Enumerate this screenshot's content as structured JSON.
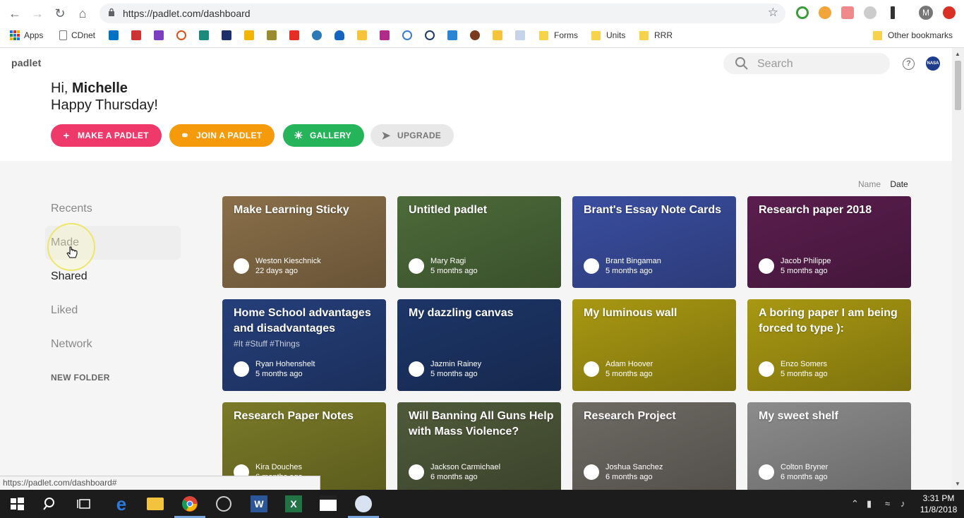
{
  "browser": {
    "url": "https://padlet.com/dashboard",
    "profile_initial": "M",
    "bookmarks": [
      {
        "label": "Apps",
        "type": "apps"
      },
      {
        "label": "CDnet",
        "type": "page"
      },
      {
        "label": "Forms",
        "type": "folder"
      },
      {
        "label": "Units",
        "type": "folder"
      },
      {
        "label": "RRR",
        "type": "folder"
      },
      {
        "label": "Other bookmarks",
        "type": "folder"
      }
    ],
    "status_url": "https://padlet.com/dashboard#"
  },
  "app": {
    "logo": "padlet",
    "search_placeholder": "Search",
    "help_label": "?",
    "avatar_text": "NASA"
  },
  "greeting": {
    "prefix": "Hi, ",
    "name": "Michelle",
    "line2": "Happy Thursday!"
  },
  "actions": {
    "make": "MAKE A PADLET",
    "join": "JOIN A PADLET",
    "gallery": "GALLERY",
    "upgrade": "UPGRADE"
  },
  "colors": {
    "make": "#f0396b",
    "join": "#f59b0b",
    "gallery": "#26b45a",
    "upgrade": "#e8e8e8"
  },
  "sort": {
    "name": "Name",
    "date": "Date",
    "active": "Date"
  },
  "sidebar": {
    "items": [
      "Recents",
      "Made",
      "Shared",
      "Liked",
      "Network"
    ],
    "active": "Shared",
    "new_folder": "NEW FOLDER"
  },
  "padlets": [
    {
      "title": "Make Learning Sticky",
      "tags": "",
      "owner": "Weston Kieschnick",
      "when": "22 days ago",
      "bg": "#8a6f49"
    },
    {
      "title": "Untitled padlet",
      "tags": "",
      "owner": "Mary Ragi",
      "when": "5 months ago",
      "bg": "#4d6b3a"
    },
    {
      "title": "Brant's Essay Note Cards",
      "tags": "",
      "owner": "Brant Bingaman",
      "when": "5 months ago",
      "bg": "#3a4ea0"
    },
    {
      "title": "Research paper 2018",
      "tags": "",
      "owner": "Jacob Philippe",
      "when": "5 months ago",
      "bg": "#5a1e4e"
    },
    {
      "title": "Home School advantages and disadvantages",
      "tags": "#It #Stuff #Things",
      "owner": "Ryan Hohenshelt",
      "when": "5 months ago",
      "bg": "#253f7a"
    },
    {
      "title": "My dazzling canvas",
      "tags": "",
      "owner": "Jazmin Rainey",
      "when": "5 months ago",
      "bg": "#1d3668"
    },
    {
      "title": "My luminous wall",
      "tags": "",
      "owner": "Adam Hoover",
      "when": "5 months ago",
      "bg": "#a89812"
    },
    {
      "title": "A boring paper I am being forced to type ):",
      "tags": "",
      "owner": "Enzo Somers",
      "when": "5 months ago",
      "bg": "#a89812"
    },
    {
      "title": "Research Paper Notes",
      "tags": "",
      "owner": "Kira Douches",
      "when": "6 months ago",
      "bg": "#7a7a28"
    },
    {
      "title": "Will Banning All Guns Help with Mass Violence?",
      "tags": "",
      "owner": "Jackson Carmichael",
      "when": "6 months ago",
      "bg": "#4f5a3a"
    },
    {
      "title": "Research Project",
      "tags": "",
      "owner": "Joshua Sanchez",
      "when": "6 months ago",
      "bg": "#6e6a64"
    },
    {
      "title": "My sweet shelf",
      "tags": "",
      "owner": "Colton Bryner",
      "when": "6 months ago",
      "bg": "#8c8c8c"
    }
  ],
  "taskbar": {
    "time": "3:31 PM",
    "date": "11/8/2018"
  }
}
